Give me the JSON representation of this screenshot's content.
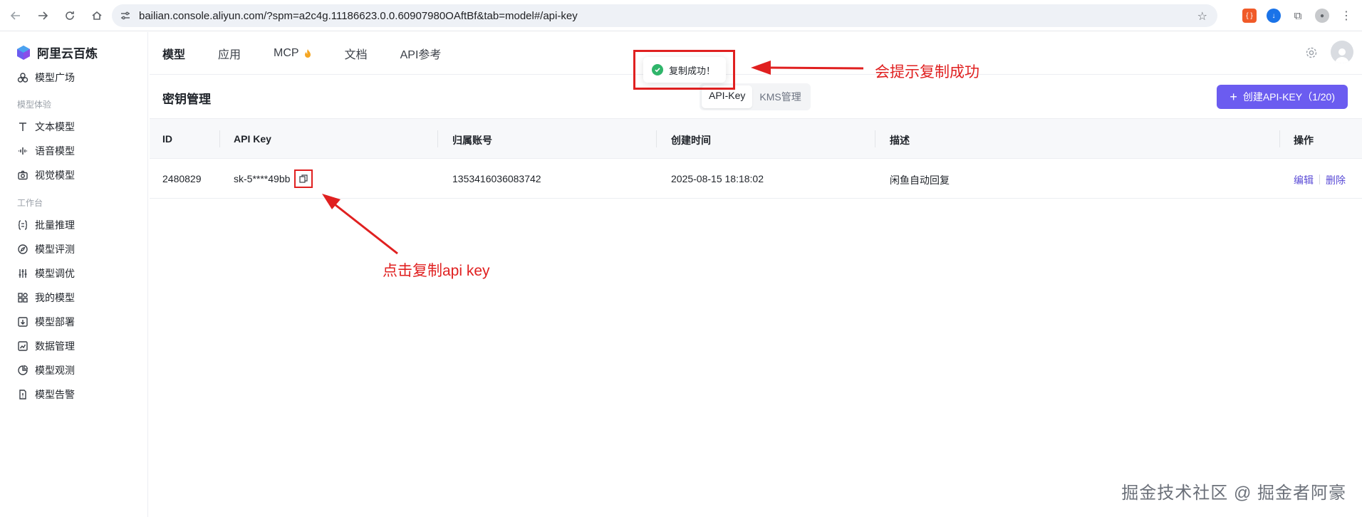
{
  "browser": {
    "url": "bailian.console.aliyun.com/?spm=a2c4g.11186623.0.0.60907980OAftBf&tab=model#/api-key"
  },
  "sidebar": {
    "brand": "阿里云百炼",
    "items": [
      {
        "label": "模型广场"
      },
      {
        "group": "模型体验"
      },
      {
        "label": "文本模型"
      },
      {
        "label": "语音模型"
      },
      {
        "label": "视觉模型"
      },
      {
        "group": "工作台"
      },
      {
        "label": "批量推理"
      },
      {
        "label": "模型评测"
      },
      {
        "label": "模型调优"
      },
      {
        "label": "我的模型"
      },
      {
        "label": "模型部署"
      },
      {
        "label": "数据管理"
      },
      {
        "label": "模型观测"
      },
      {
        "label": "模型告警"
      }
    ]
  },
  "topnav": {
    "tabs": [
      "模型",
      "应用",
      "MCP",
      "文档",
      "API参考"
    ]
  },
  "panel": {
    "title": "密钥管理",
    "segments": [
      "API-Key",
      "KMS管理"
    ],
    "create_button": "创建API-KEY（1/20)"
  },
  "table": {
    "headers": [
      "ID",
      "API Key",
      "归属账号",
      "创建时间",
      "描述",
      "操作"
    ],
    "rows": [
      {
        "id": "2480829",
        "api_key": "sk-5****49bb",
        "account": "1353416036083742",
        "created": "2025-08-15 18:18:02",
        "description": "闲鱼自动回复",
        "actions": [
          "编辑",
          "删除"
        ]
      }
    ]
  },
  "toast": {
    "text": "复制成功！"
  },
  "annotations": {
    "toast_note": "会提示复制成功",
    "copy_note": "点击复制api key"
  },
  "watermark": "掘金技术社区 @ 掘金者阿豪",
  "colors": {
    "accent": "#6b5cf0",
    "annotation": "#e02020",
    "success": "#2fb56a"
  }
}
